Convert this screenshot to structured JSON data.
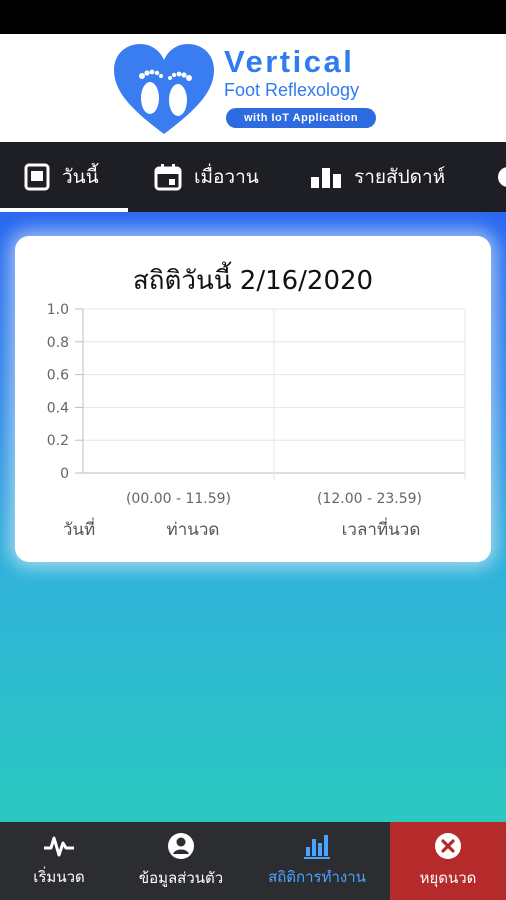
{
  "logo": {
    "title": "Vertical",
    "subtitle": "Foot Reflexology",
    "pill": "with IoT Application"
  },
  "tabs": [
    {
      "label": "วันนี้",
      "icon": "tablet-icon",
      "active": true
    },
    {
      "label": "เมื่อวาน",
      "icon": "calendar-icon",
      "active": false
    },
    {
      "label": "รายสัปดาห์",
      "icon": "bar-chart-icon",
      "active": false
    }
  ],
  "card": {
    "title": "สถิติวันนี้ 2/16/2020"
  },
  "chart_data": {
    "type": "bar",
    "title": "สถิติวันนี้ 2/16/2020",
    "categories": [
      "(00.00 - 11.59)",
      "(12.00 - 23.59)"
    ],
    "series": [],
    "ylim": [
      0,
      1.0
    ],
    "yticks": [
      "1.0",
      "0.8",
      "0.6",
      "0.4",
      "0.2",
      "0"
    ],
    "row_labels": [
      "วันที่",
      "ท่านวด",
      "เวลาที่นวด"
    ],
    "grid": true
  },
  "bottom_nav": [
    {
      "label": "เริ่มนวด",
      "icon": "pulse-icon"
    },
    {
      "label": "ข้อมูลส่วนตัว",
      "icon": "user-circle-icon"
    },
    {
      "label": "สถิติการทำงาน",
      "icon": "stats-icon",
      "active": true
    },
    {
      "label": "หยุดนวด",
      "icon": "close-circle-icon"
    }
  ],
  "colors": {
    "brand_blue": "#2f7cf0",
    "tab_bar": "#1e1f24",
    "bottom_bar": "#2b2d31",
    "active_nav": "#4aa3ff",
    "stop_button": "#b52a2a"
  }
}
